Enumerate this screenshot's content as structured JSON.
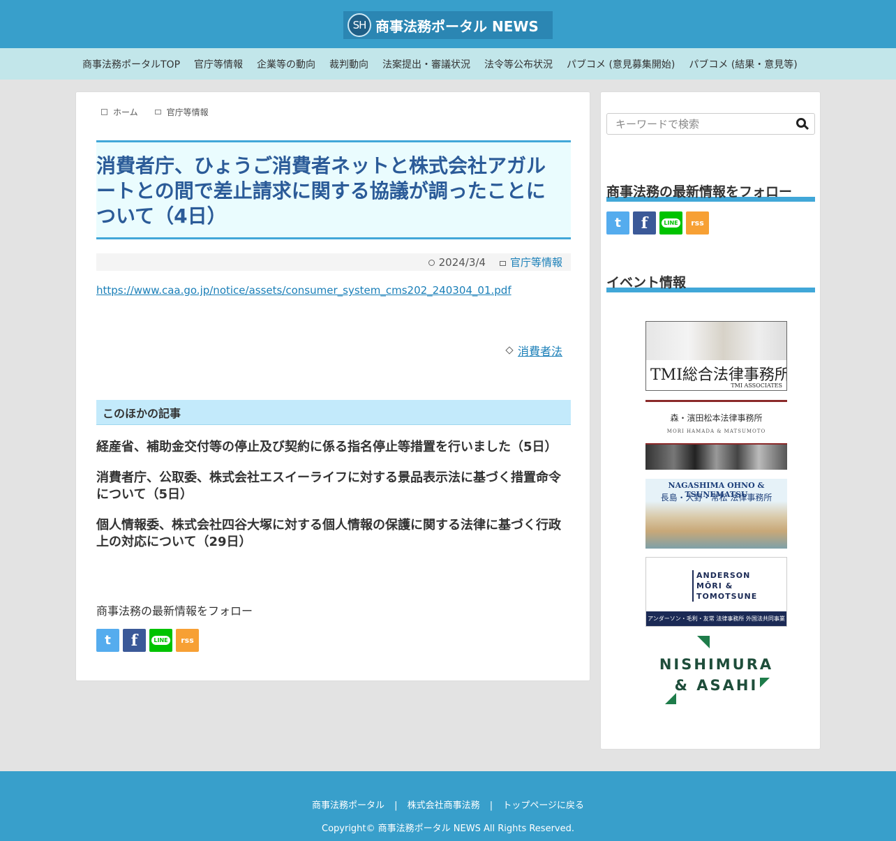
{
  "header": {
    "logo_mark": "SH",
    "logo_text": "商事法務ポータル NEWS"
  },
  "nav": {
    "items": [
      "商事法務ポータルTOP",
      "官庁等情報",
      "企業等の動向",
      "裁判動向",
      "法案提出・審議状況",
      "法令等公布状況",
      "パブコメ (意見募集開始)",
      "パブコメ (結果・意見等)"
    ]
  },
  "breadcrumb": {
    "home": "ホーム",
    "category": "官庁等情報"
  },
  "article": {
    "title": "消費者庁、ひょうご消費者ネットと株式会社アガルートとの間で差止請求に関する協議が調ったことについて（4日）",
    "date": "2024/3/4",
    "category": "官庁等情報",
    "source_link": "https://www.caa.go.jp/notice/assets/consumer_system_cms202_240304_01.pdf",
    "tag": "消費者法"
  },
  "related": {
    "heading": "このほかの記事",
    "items": [
      "経産省、補助金交付等の停止及び契約に係る指名停止等措置を行いました（5日）",
      "消費者庁、公取委、株式会社エスイーライフに対する景品表示法に基づく措置命令について（5日）",
      "個人情報委、株式会社四谷大塚に対する個人情報の保護に関する法律に基づく行政上の対応について（29日）"
    ]
  },
  "follow": {
    "label": "商事法務の最新情報をフォロー"
  },
  "sns": {
    "twitter": "t",
    "facebook": "f",
    "line": "LINE",
    "rss": "rss"
  },
  "sidebar": {
    "search_placeholder": "キーワードで検索",
    "follow_title": "商事法務の最新情報をフォロー",
    "events_title": "イベント情報",
    "banners": {
      "tmi": "TMI総合法律事務所",
      "tmi_sub": "TMI ASSOCIATES",
      "mori": "森・濱田松本法律事務所",
      "mori_sub": "MORI HAMADA & MATSUMOTO",
      "not_en": "NAGASHIMA OHNO & TSUNEMATSU",
      "not_ja": "長島・大野・常松 法律事務所",
      "amt_line1": "ANDERSON",
      "amt_line2": "MŌRI &",
      "amt_line3": "TOMOTSUNE",
      "amt_foot": "アンダーソン・毛利・友常 法律事務所 外国法共同事業",
      "nishimura_line1": "NISHIMURA",
      "nishimura_line2": "& ASAHI"
    }
  },
  "footer": {
    "links": [
      "商事法務ポータル",
      "株式会社商事法務",
      "トップページに戻る"
    ],
    "separator": "|",
    "copyright": "Copyright© 商事法務ポータル NEWS All Rights Reserved."
  },
  "colors": {
    "header_bg": "#389fcb",
    "nav_bg": "#c2e6ea",
    "title_color": "#2b5b98",
    "accent": "#41a7d8",
    "link": "#1a7fb8"
  }
}
